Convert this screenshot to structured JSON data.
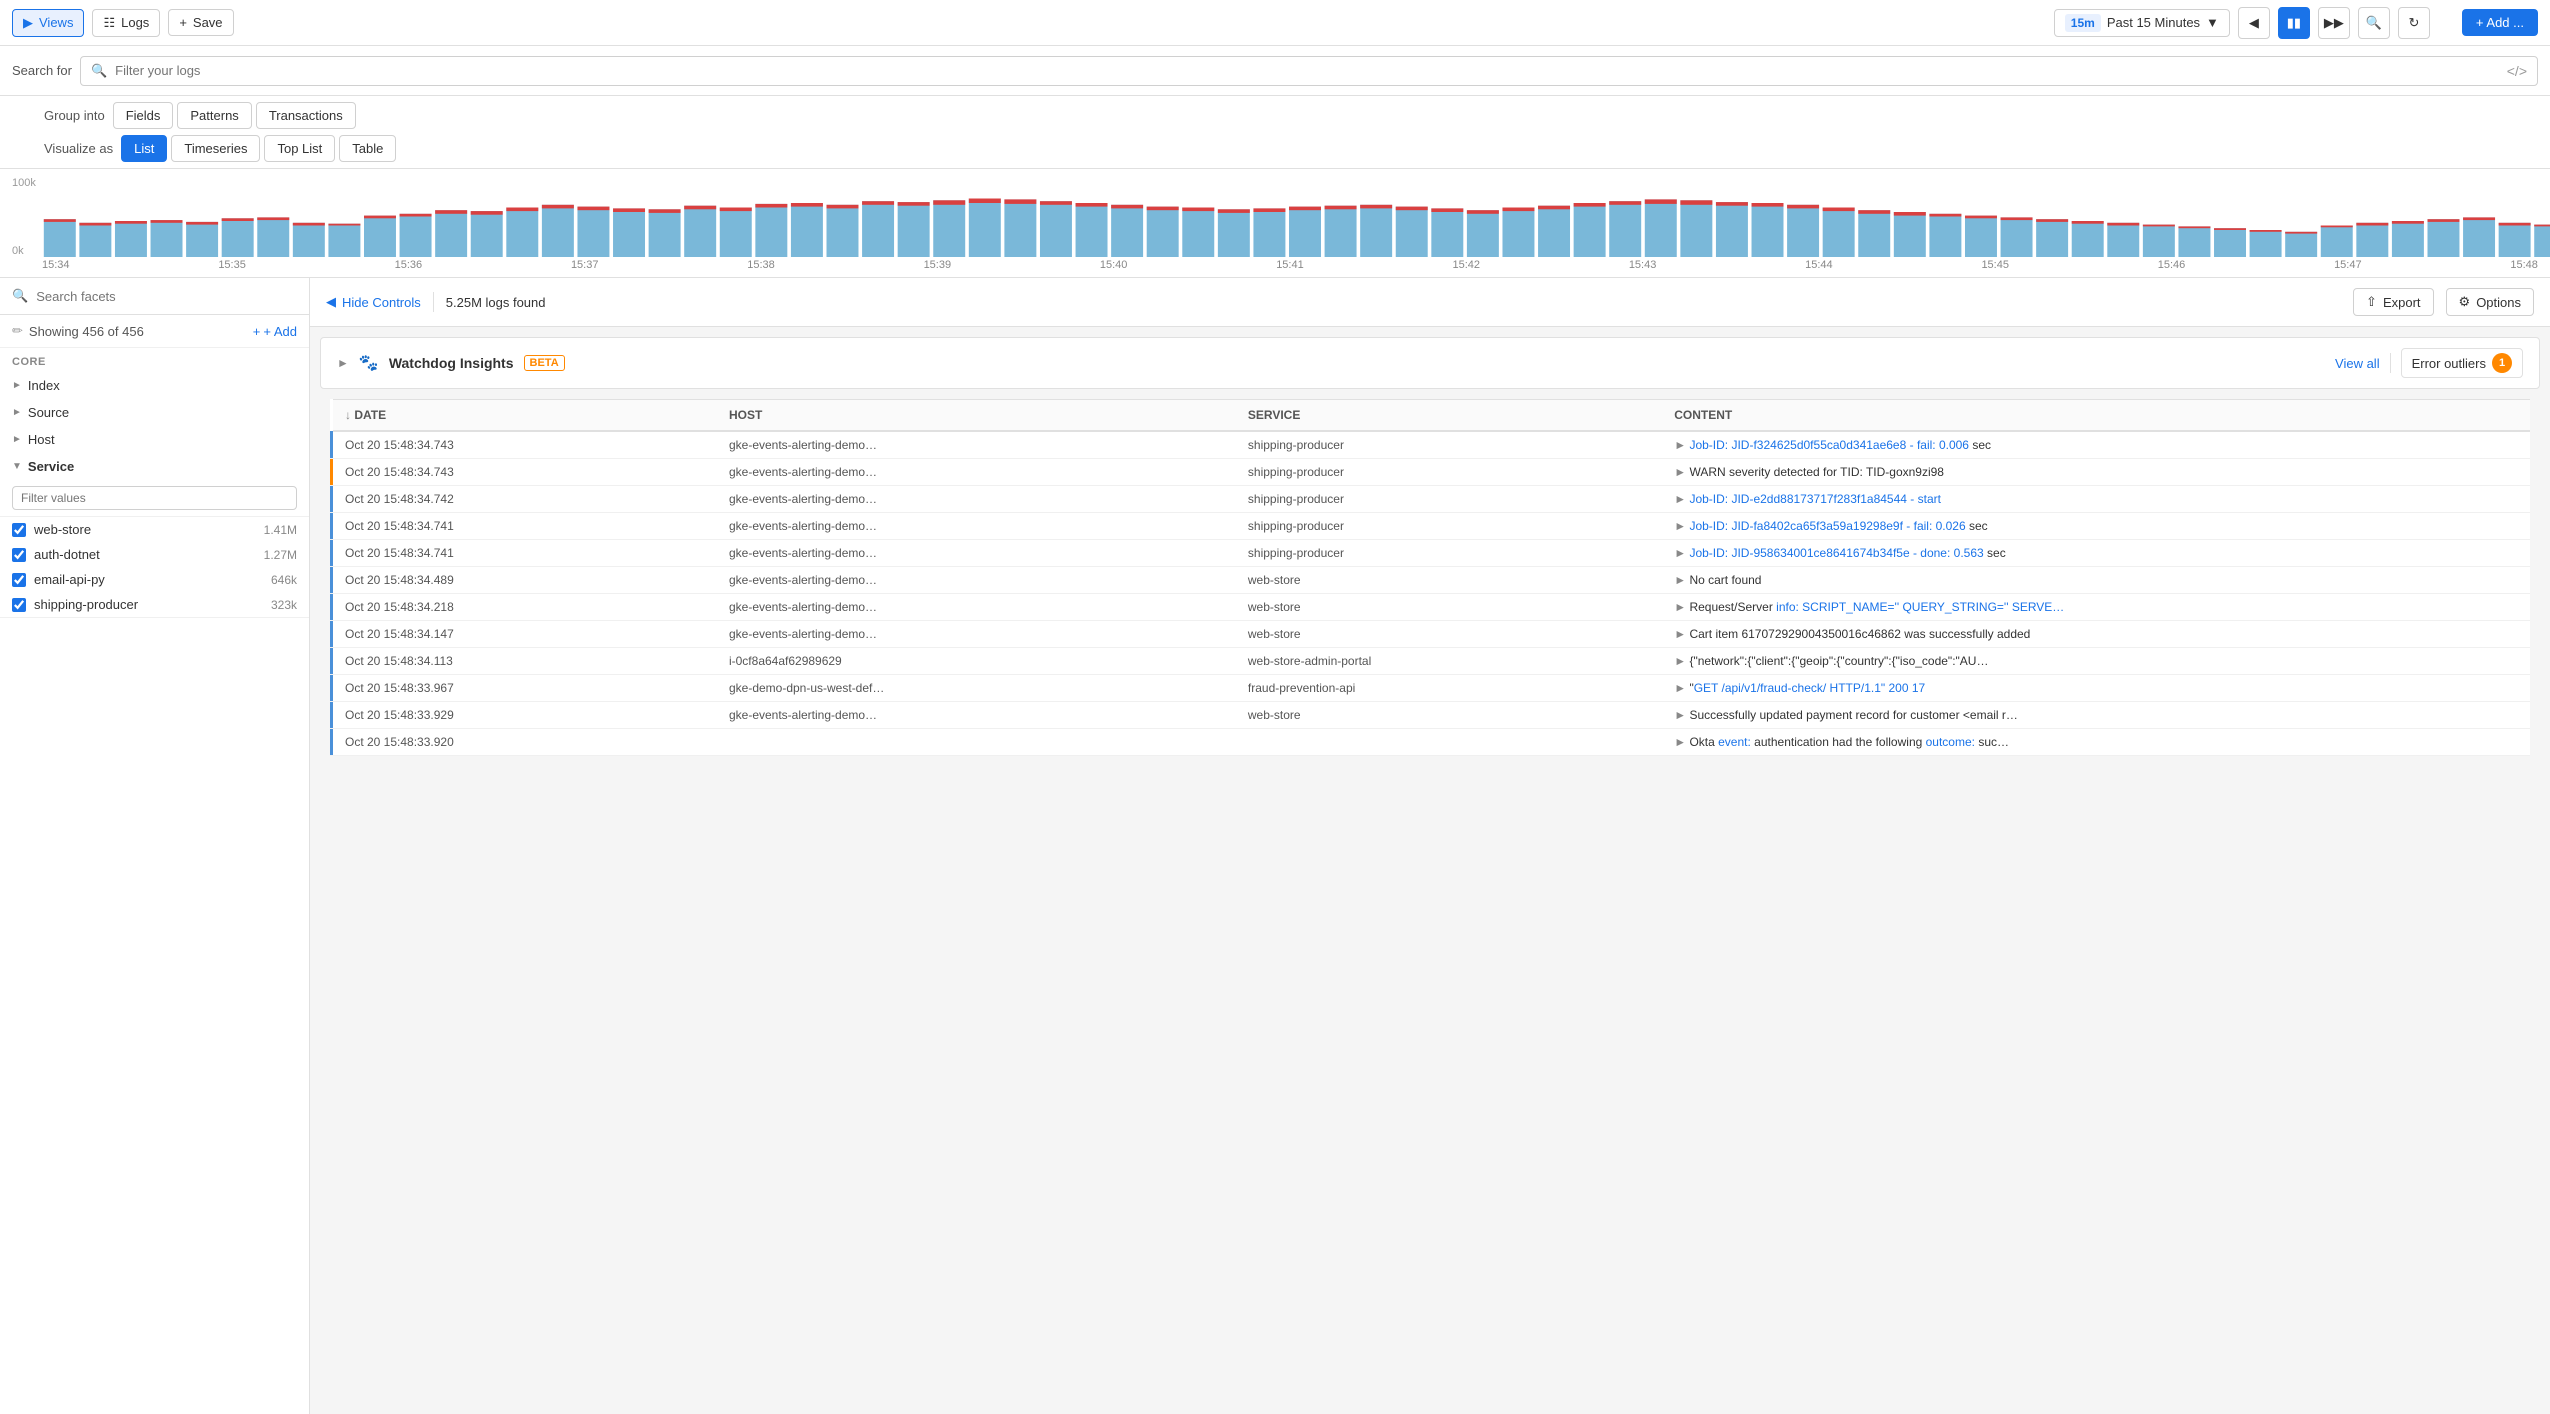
{
  "nav": {
    "views_label": "Views",
    "logs_label": "Logs",
    "save_label": "Save",
    "time_badge": "15m",
    "time_range": "Past 15 Minutes",
    "add_label": "+ Add ..."
  },
  "search": {
    "label": "Search for",
    "placeholder": "Filter your logs"
  },
  "toolbar": {
    "group_into_label": "Group into",
    "group_options": [
      "Fields",
      "Patterns",
      "Transactions"
    ],
    "visualize_label": "Visualize as",
    "visualize_options": [
      "List",
      "Timeseries",
      "Top List",
      "Table"
    ],
    "active_visualize": "List"
  },
  "chart": {
    "y_max": "100k",
    "y_min": "0k",
    "times": [
      "15:34",
      "15:35",
      "15:36",
      "15:37",
      "15:38",
      "15:39",
      "15:40",
      "15:41",
      "15:42",
      "15:43",
      "15:44",
      "15:45",
      "15:46",
      "15:47",
      "15:48"
    ]
  },
  "sidebar": {
    "search_placeholder": "Search facets",
    "showing_label": "Showing 456 of 456",
    "add_label": "+ Add",
    "core_label": "CORE",
    "index_label": "Index",
    "source_label": "Source",
    "host_label": "Host",
    "service_label": "Service",
    "filter_placeholder": "Filter values",
    "services": [
      {
        "name": "web-store",
        "count": "1.41M",
        "checked": true
      },
      {
        "name": "auth-dotnet",
        "count": "1.27M",
        "checked": true
      },
      {
        "name": "email-api-py",
        "count": "646k",
        "checked": true
      },
      {
        "name": "shipping-producer",
        "count": "323k",
        "checked": true
      }
    ]
  },
  "panel": {
    "hide_controls_label": "Hide Controls",
    "logs_found": "5.25M logs found",
    "export_label": "Export",
    "options_label": "Options",
    "watchdog_title": "Watchdog Insights",
    "watchdog_beta": "BETA",
    "view_all_label": "View all",
    "error_outliers_label": "Error outliers",
    "error_outliers_count": "1"
  },
  "table": {
    "columns": [
      "DATE",
      "HOST",
      "SERVICE",
      "CONTENT"
    ],
    "rows": [
      {
        "level": "blue",
        "date": "Oct 20 15:48:34.743",
        "host": "gke-events-alerting-demo…",
        "service": "shipping-producer",
        "content": "Job-ID: JID-f324625d0f55ca0d341ae6e8 - fail: 0.006 sec"
      },
      {
        "level": "orange",
        "date": "Oct 20 15:48:34.743",
        "host": "gke-events-alerting-demo…",
        "service": "shipping-producer",
        "content": "WARN severity detected for TID: TID-goxn9zi98"
      },
      {
        "level": "blue",
        "date": "Oct 20 15:48:34.742",
        "host": "gke-events-alerting-demo…",
        "service": "shipping-producer",
        "content": "Job-ID: JID-e2dd88173717f283f1a84544 - start"
      },
      {
        "level": "blue",
        "date": "Oct 20 15:48:34.741",
        "host": "gke-events-alerting-demo…",
        "service": "shipping-producer",
        "content": "Job-ID: JID-fa8402ca65f3a59a19298e9f - fail: 0.026 sec"
      },
      {
        "level": "blue",
        "date": "Oct 20 15:48:34.741",
        "host": "gke-events-alerting-demo…",
        "service": "shipping-producer",
        "content": "Job-ID: JID-958634001ce8641674b34f5e - done: 0.563 sec"
      },
      {
        "level": "blue",
        "date": "Oct 20 15:48:34.489",
        "host": "gke-events-alerting-demo…",
        "service": "web-store",
        "content": "No cart found"
      },
      {
        "level": "blue",
        "date": "Oct 20 15:48:34.218",
        "host": "gke-events-alerting-demo…",
        "service": "web-store",
        "content": "Request/Server info: SCRIPT_NAME='' QUERY_STRING='' SERVE…"
      },
      {
        "level": "blue",
        "date": "Oct 20 15:48:34.147",
        "host": "gke-events-alerting-demo…",
        "service": "web-store",
        "content": "Cart item 617072929004350016c46862 was successfully added"
      },
      {
        "level": "blue",
        "date": "Oct 20 15:48:34.113",
        "host": "i-0cf8a64af62989629",
        "service": "web-store-admin-portal",
        "content": "{\"network\":{\"client\":{\"geoip\":{\"country\":{\"iso_code\":\"AU…"
      },
      {
        "level": "blue",
        "date": "Oct 20 15:48:33.967",
        "host": "gke-demo-dpn-us-west-def…",
        "service": "fraud-prevention-api",
        "content": "\"GET /api/v1/fraud-check/ HTTP/1.1\" 200 17"
      },
      {
        "level": "blue",
        "date": "Oct 20 15:48:33.929",
        "host": "gke-events-alerting-demo…",
        "service": "web-store",
        "content": "Successfully updated payment record for customer <email r…"
      },
      {
        "level": "blue",
        "date": "Oct 20 15:48:33.920",
        "host": "",
        "service": "",
        "content": "Okta event: authentication had the following outcome: suc…"
      }
    ]
  }
}
